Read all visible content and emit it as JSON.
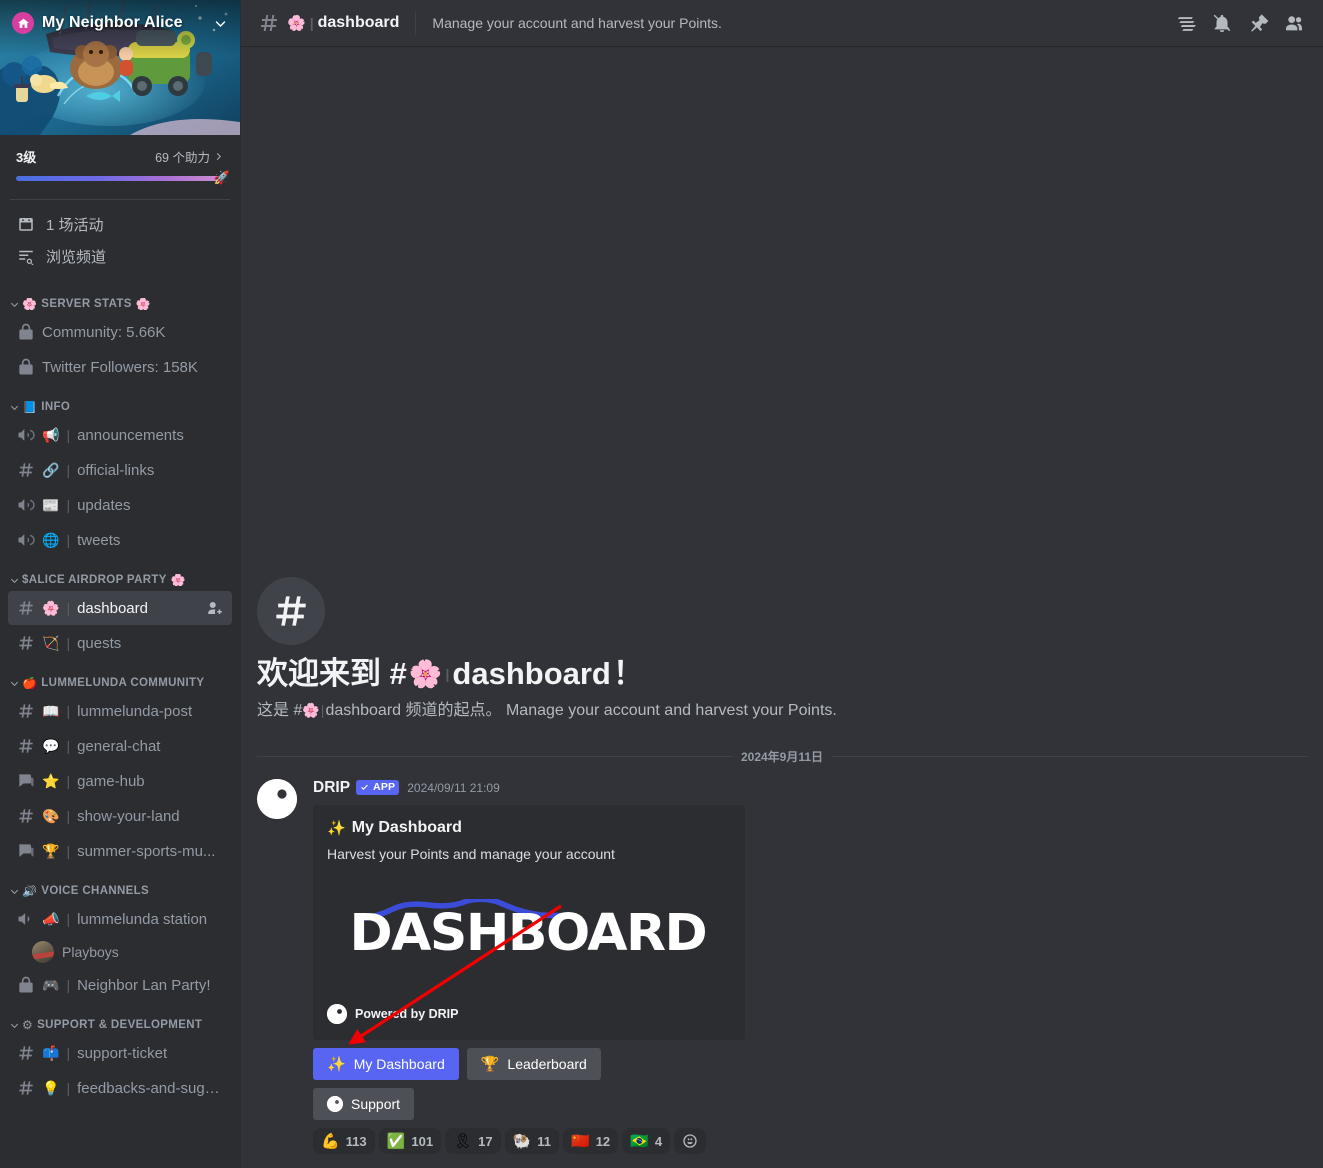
{
  "server": {
    "name": "My Neighbor Alice",
    "home_icon": "home-icon",
    "dropdown_icon": "chevron-down-icon",
    "boost": {
      "level_label": "3级",
      "count_label": "69 个助力",
      "chevron_icon": "chevron-right-icon",
      "bar_start_color": "#4a6ee0",
      "bar_end_color": "#cf8fd0"
    }
  },
  "quick_links": [
    {
      "label": "1 场活动",
      "icon": "calendar-icon",
      "name": "events"
    },
    {
      "label": "浏览频道",
      "icon": "browse-channels-icon",
      "name": "browse-channels"
    }
  ],
  "categories": [
    {
      "name": "SERVER STATS",
      "emoji_left": "🌸",
      "emoji_right": "🌸",
      "channels": [
        {
          "label": "Community: 5.66K",
          "icon": "lock-icon",
          "emoji": "",
          "separator": false
        },
        {
          "label": "Twitter Followers: 158K",
          "icon": "lock-icon",
          "emoji": "",
          "separator": false
        }
      ]
    },
    {
      "name": "INFO",
      "emoji_left": "📘",
      "emoji_right": "",
      "channels": [
        {
          "label": "announcements",
          "icon": "announcement-channel-icon",
          "emoji": "📢",
          "separator": true
        },
        {
          "label": "official-links",
          "icon": "text-locked-icon",
          "emoji": "🔗",
          "separator": true
        },
        {
          "label": "updates",
          "icon": "announcement-channel-icon",
          "emoji": "📰",
          "separator": true
        },
        {
          "label": "tweets",
          "icon": "announcement-channel-icon",
          "emoji": "🌐",
          "separator": true
        }
      ]
    },
    {
      "name": "$ALICE AIRDROP PARTY",
      "emoji_left": "",
      "emoji_right": "🌸",
      "channels": [
        {
          "label": "dashboard",
          "icon": "text-locked-icon",
          "emoji": "🌸",
          "separator": true,
          "active": true,
          "action_icon": "add-members-icon"
        },
        {
          "label": "quests",
          "icon": "text-locked-icon",
          "emoji": "🏹",
          "separator": true
        }
      ]
    },
    {
      "name": "LUMMELUNDA COMMUNITY",
      "emoji_left": "🍎",
      "emoji_right": "",
      "channels": [
        {
          "label": "lummelunda-post",
          "icon": "text-locked-icon",
          "emoji": "📖",
          "separator": true
        },
        {
          "label": "general-chat",
          "icon": "text-locked-icon",
          "emoji": "💬",
          "separator": true
        },
        {
          "label": "game-hub",
          "icon": "forum-locked-icon",
          "emoji": "⭐",
          "separator": true
        },
        {
          "label": "show-your-land",
          "icon": "text-locked-icon",
          "emoji": "🎨",
          "separator": true
        },
        {
          "label": "summer-sports-mu...",
          "icon": "forum-locked-icon",
          "emoji": "🏆",
          "separator": true
        }
      ]
    },
    {
      "name": "VOICE CHANNELS",
      "emoji_left": "🔊",
      "emoji_right": "",
      "channels": [
        {
          "label": "lummelunda station",
          "icon": "voice-locked-icon",
          "emoji": "📣",
          "separator": true
        },
        {
          "label": "Playboys",
          "icon": "user-avatar",
          "emoji": "",
          "separator": false,
          "is_user": true
        },
        {
          "label": "Neighbor Lan Party!",
          "icon": "lock-icon",
          "emoji": "🎮",
          "separator": true
        }
      ]
    },
    {
      "name": "SUPPORT & DEVELOPMENT",
      "emoji_left": "⚙",
      "emoji_right": "",
      "channels": [
        {
          "label": "support-ticket",
          "icon": "text-locked-icon",
          "emoji": "📫",
          "separator": true
        },
        {
          "label": "feedbacks-and-sugg...",
          "icon": "text-locked-icon",
          "emoji": "💡",
          "separator": true
        }
      ]
    }
  ],
  "topbar": {
    "hash_icon": "hash-locked-icon",
    "channel_emoji": "🌸",
    "channel_name": "dashboard",
    "topic": "Manage your account and harvest your Points.",
    "icons": [
      {
        "name": "threads-icon",
        "label": "Threads"
      },
      {
        "name": "notification-muted-icon",
        "label": "Notification Settings"
      },
      {
        "name": "pin-icon",
        "label": "Pinned Messages"
      },
      {
        "name": "members-icon",
        "label": "Member List"
      }
    ]
  },
  "welcome": {
    "hash_icon": "hash-icon",
    "title_prefix": "欢迎来到 #",
    "title_emoji": "🌸",
    "title_name": "dashboard",
    "title_suffix": "！",
    "sub_prefix": "这是 #",
    "sub_emoji": "🌸",
    "sub_middle": "dashboard 频道的起点。",
    "sub_topic": "Manage your account and harvest your Points."
  },
  "date_divider": "2024年9月11日",
  "message": {
    "author": "DRIP",
    "app_tag": "APP",
    "app_tag_icon": "verified-check-icon",
    "timestamp": "2024/09/11 21:09",
    "avatar_icon": "drip-logo-icon",
    "embed": {
      "title_emoji": "✨",
      "title": "My Dashboard",
      "description": "Harvest your Points and manage your account",
      "image_text": "DASHBOARD",
      "image_accent_color": "#3b4cd8",
      "footer_icon": "drip-logo-icon",
      "footer_text": "Powered by DRIP"
    },
    "buttons": [
      [
        {
          "label": "My Dashboard",
          "emoji": "✨",
          "style": "primary",
          "name": "my-dashboard-button"
        },
        {
          "label": "Leaderboard",
          "emoji": "🏆",
          "style": "secondary",
          "name": "leaderboard-button"
        }
      ],
      [
        {
          "label": "Support",
          "emoji": "drip",
          "style": "secondary",
          "name": "support-button"
        }
      ]
    ],
    "reactions": [
      {
        "emoji": "💪",
        "count": "113"
      },
      {
        "emoji": "✅",
        "count": "101"
      },
      {
        "emoji": "🎗",
        "count": "17"
      },
      {
        "emoji": "🐏",
        "count": "11"
      },
      {
        "emoji": "🇨🇳",
        "count": "12"
      },
      {
        "emoji": "🇧🇷",
        "count": "4"
      }
    ],
    "add_reaction_icon": "add-reaction-icon"
  },
  "annotation": {
    "arrow_color": "#f40000",
    "name": "red-pointer-arrow"
  },
  "theme": {
    "sidebar_bg": "#2b2d31",
    "main_bg": "#313338",
    "blurple": "#5865f2",
    "embed_bg": "#2b2d31",
    "text_muted": "#949ba4",
    "text_normal": "#dbdee1"
  }
}
